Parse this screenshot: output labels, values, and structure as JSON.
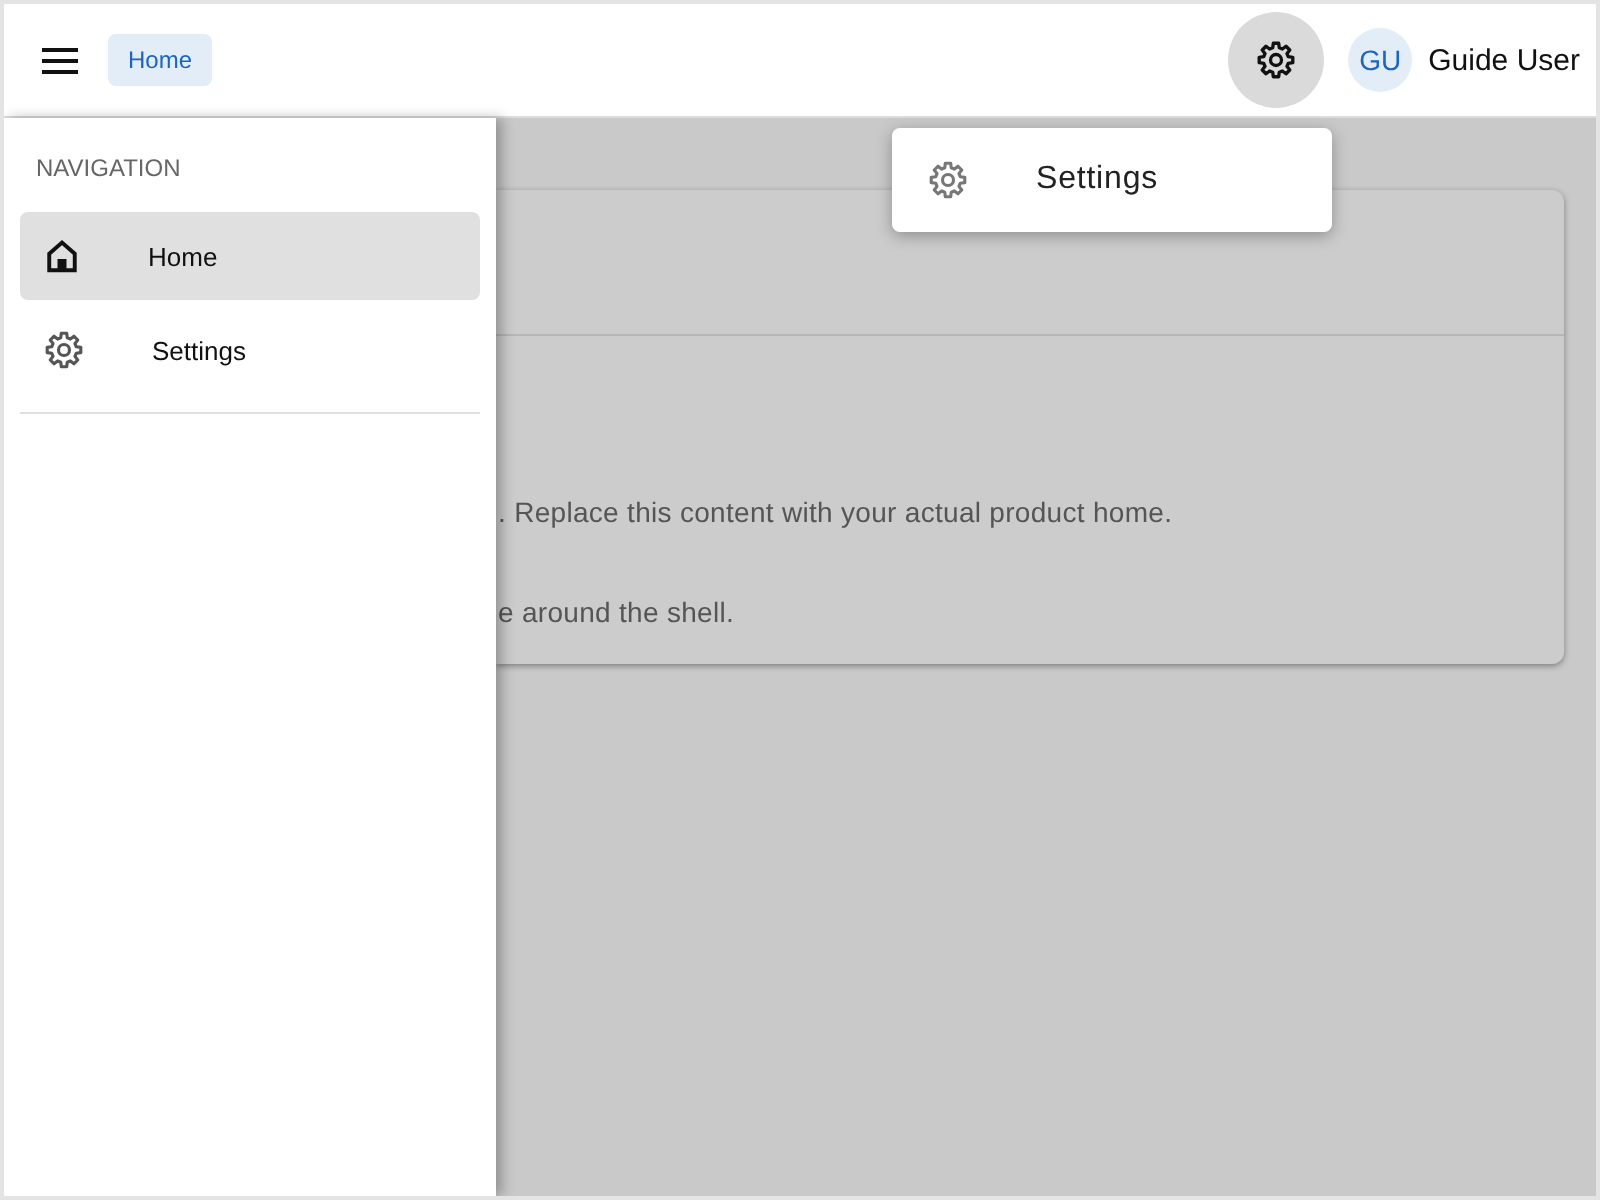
{
  "top_bar": {
    "breadcrumb": {
      "label": "Home"
    },
    "user": {
      "initials": "GU",
      "name": "Guide User"
    }
  },
  "settings_menu": {
    "open": true,
    "items": [
      {
        "label": "Settings"
      }
    ]
  },
  "drawer": {
    "open": true,
    "heading": "NAVIGATION",
    "items": [
      {
        "kind": "home",
        "label": "Home",
        "selected": true
      },
      {
        "kind": "settings",
        "label": "Settings",
        "selected": false
      }
    ]
  },
  "content_card": {
    "lines": [
      ". Replace this content with your actual product home.",
      "e around the shell."
    ]
  }
}
